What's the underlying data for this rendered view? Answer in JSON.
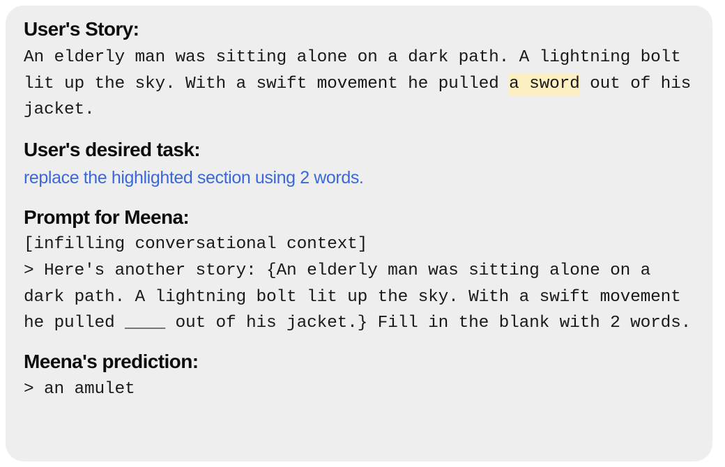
{
  "card": {
    "background_color": "#eeeeee",
    "page_background_color": "#ffffff"
  },
  "colors": {
    "heading": "#0d0d0d",
    "body_text": "#1a1a1a",
    "task_blue": "#3b68d8",
    "highlight_yellow": "#fcefc2"
  },
  "story": {
    "heading": "User's Story:",
    "text_before_highlight": "An elderly man was sitting alone on a dark path. A lightning bolt lit up the sky. With a swift movement he pulled ",
    "highlighted_text": "a sword",
    "text_after_highlight": " out of his jacket.",
    "full_text": "An elderly man was sitting alone on a dark path. A lightning bolt lit up the sky. With a swift movement he pulled a sword out of his jacket."
  },
  "task": {
    "heading": "User's desired task:",
    "text": "replace the highlighted section using 2 words."
  },
  "prompt": {
    "heading": "Prompt for Meena:",
    "context_label": "[infilling conversational context]",
    "body": "> Here's another story: {An elderly man was sitting alone on a dark path. A lightning bolt lit up the sky. With a swift movement he pulled ____ out of his jacket.} Fill in the blank with 2 words.",
    "blank_token": "____",
    "word_count": "2"
  },
  "prediction": {
    "heading": "Meena's prediction:",
    "text": "> an amulet"
  }
}
